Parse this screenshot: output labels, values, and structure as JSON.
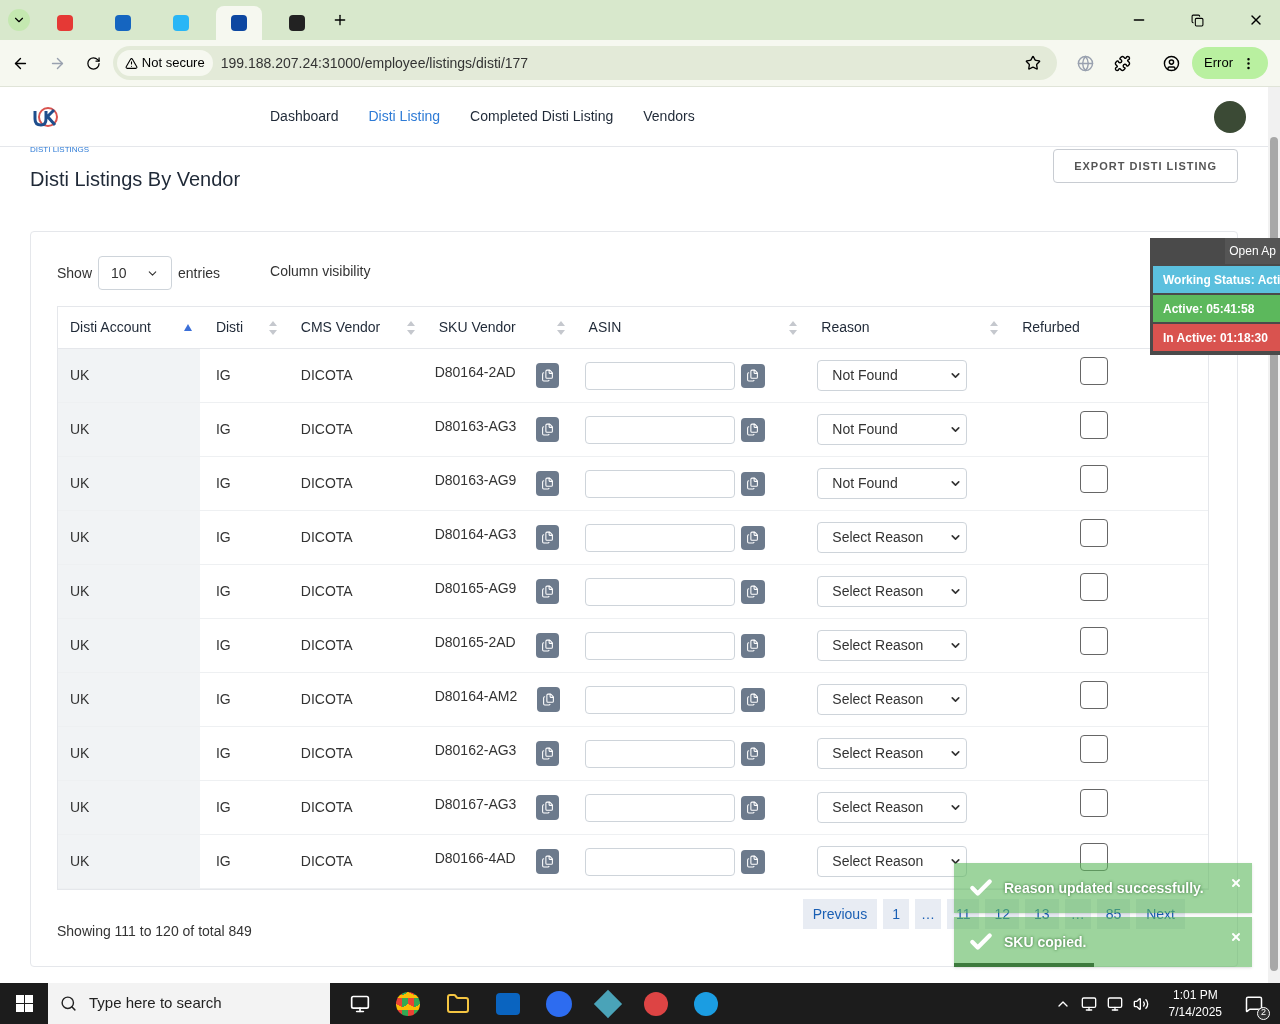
{
  "browser": {
    "tabs": [
      {
        "selected": false
      },
      {
        "selected": false
      },
      {
        "selected": false
      },
      {
        "selected": true
      },
      {
        "selected": false
      }
    ],
    "security": "Not secure",
    "url": "199.188.207.24:31000/employee/listings/disti/177",
    "profile_button": "Error"
  },
  "nav": {
    "items": [
      {
        "label": "Dashboard",
        "selected": false
      },
      {
        "label": "Disti Listing",
        "selected": true
      },
      {
        "label": "Completed Disti Listing",
        "selected": false
      },
      {
        "label": "Vendors",
        "selected": false
      }
    ]
  },
  "breadcrumb": "DISTI LISTINGS",
  "title": "Disti Listings By Vendor",
  "export_button": "EXPORT DISTI LISTING",
  "length": {
    "show": "Show",
    "value": "10",
    "entries": "entries"
  },
  "column_visibility": "Column visibility",
  "table": {
    "columns": [
      {
        "label": "Disti Account",
        "sortable": true,
        "sorted": true
      },
      {
        "label": "Disti",
        "sortable": true,
        "sorted": false
      },
      {
        "label": "CMS Vendor",
        "sortable": true,
        "sorted": false
      },
      {
        "label": "SKU Vendor",
        "sortable": true,
        "sorted": false
      },
      {
        "label": "ASIN",
        "sortable": true,
        "sorted": false
      },
      {
        "label": "Reason",
        "sortable": true,
        "sorted": false
      },
      {
        "label": "Refurbed",
        "sortable": false
      }
    ],
    "rows": [
      {
        "account": "UK",
        "disti": "IG",
        "vendor": "DICOTA",
        "sku": "D80164-2AD",
        "reason": "Not Found",
        "refurbed": false
      },
      {
        "account": "UK",
        "disti": "IG",
        "vendor": "DICOTA",
        "sku": "D80163-AG3",
        "reason": "Not Found",
        "refurbed": false
      },
      {
        "account": "UK",
        "disti": "IG",
        "vendor": "DICOTA",
        "sku": "D80163-AG9",
        "reason": "Not Found",
        "refurbed": false
      },
      {
        "account": "UK",
        "disti": "IG",
        "vendor": "DICOTA",
        "sku": "D80164-AG3",
        "reason": "Select Reason",
        "refurbed": false
      },
      {
        "account": "UK",
        "disti": "IG",
        "vendor": "DICOTA",
        "sku": "D80165-AG9",
        "reason": "Select Reason",
        "refurbed": false
      },
      {
        "account": "UK",
        "disti": "IG",
        "vendor": "DICOTA",
        "sku": "D80165-2AD",
        "reason": "Select Reason",
        "refurbed": false
      },
      {
        "account": "UK",
        "disti": "IG",
        "vendor": "DICOTA",
        "sku": "D80164-AM2",
        "reason": "Select Reason",
        "refurbed": false
      },
      {
        "account": "UK",
        "disti": "IG",
        "vendor": "DICOTA",
        "sku": "D80162-AG3",
        "reason": "Select Reason",
        "refurbed": false
      },
      {
        "account": "UK",
        "disti": "IG",
        "vendor": "DICOTA",
        "sku": "D80167-AG3",
        "reason": "Select Reason",
        "refurbed": false
      },
      {
        "account": "UK",
        "disti": "IG",
        "vendor": "DICOTA",
        "sku": "D80166-4AD",
        "reason": "Select Reason",
        "refurbed": false
      }
    ]
  },
  "info": "Showing 111 to 120 of total 849",
  "pagination": [
    {
      "label": "Previous",
      "kind": "nav"
    },
    {
      "label": "1",
      "kind": "page"
    },
    {
      "label": "…",
      "kind": "gap"
    },
    {
      "label": "11",
      "kind": "page"
    },
    {
      "label": "12",
      "kind": "page"
    },
    {
      "label": "13",
      "kind": "page"
    },
    {
      "label": "…",
      "kind": "gap"
    },
    {
      "label": "85",
      "kind": "page"
    },
    {
      "label": "Next",
      "kind": "nav"
    }
  ],
  "status_widget": {
    "button": "Open Ap",
    "items": [
      {
        "label": "Working Status: Acti",
        "color": "#5bc0de"
      },
      {
        "label": "Active: 05:41:58",
        "color": "#5cb85c"
      },
      {
        "label": "In Active: 01:18:30",
        "color": "#d9534f"
      }
    ]
  },
  "toasts": [
    {
      "message": "Reason updated successfully."
    },
    {
      "message": "SKU copied.",
      "level": 0.47
    }
  ],
  "taskbar": {
    "search": "Type here to search",
    "time": "1:01 PM",
    "date": "7/14/2025",
    "notifications": "2"
  }
}
